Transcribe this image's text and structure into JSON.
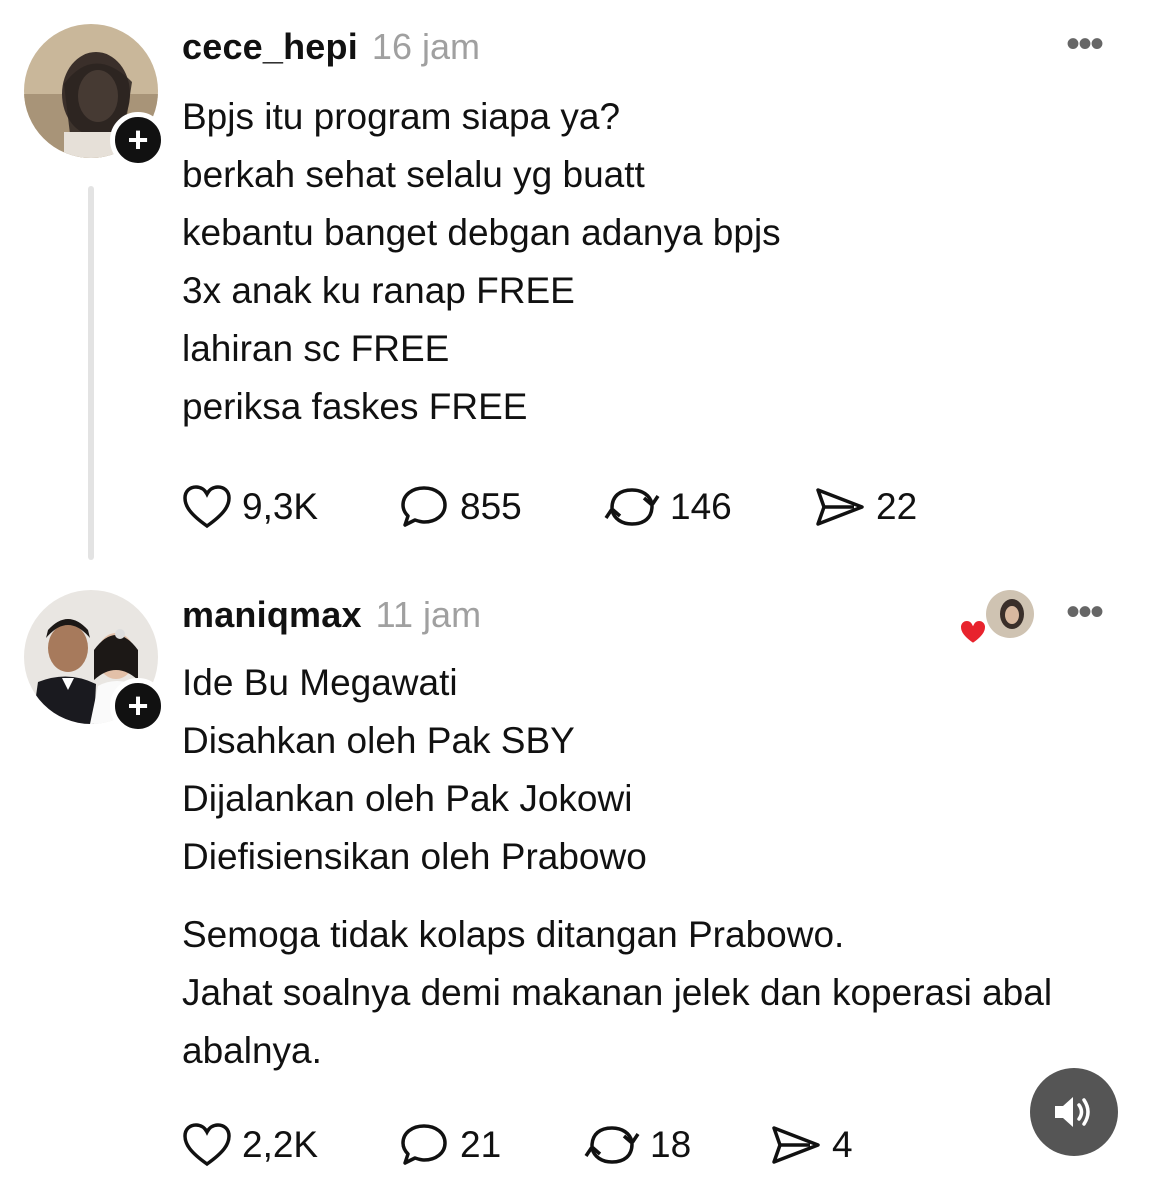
{
  "posts": [
    {
      "username": "cece_hepi",
      "time": "16 jam",
      "avatar_icon": "avatar-photo",
      "lines": [
        "Bpjs itu program siapa ya?",
        "berkah sehat selalu yg buatt",
        "kebantu banget debgan adanya bpjs",
        "3x anak ku ranap FREE",
        "lahiran sc FREE",
        "periksa faskes FREE"
      ],
      "stats": {
        "likes": "9,3K",
        "comments": "855",
        "reposts": "146",
        "shares": "22"
      }
    },
    {
      "username": "maniqmax",
      "time": "11 jam",
      "avatar_icon": "avatar-photo",
      "lines": [
        "Ide Bu Megawati",
        "Disahkan oleh Pak SBY",
        "Dijalankan oleh Pak Jokowi",
        "Diefisiensikan oleh Prabowo"
      ],
      "lines2": [
        "Semoga tidak kolaps ditangan Prabowo.",
        "Jahat soalnya demi makanan jelek dan koperasi abal",
        "abalnya."
      ],
      "stats": {
        "likes": "2,2K",
        "comments": "21",
        "reposts": "18",
        "shares": "4"
      }
    }
  ],
  "colors": {
    "text": "#111111",
    "meta": "#a0a0a0",
    "heart": "#e8232d",
    "fab": "#555555"
  }
}
